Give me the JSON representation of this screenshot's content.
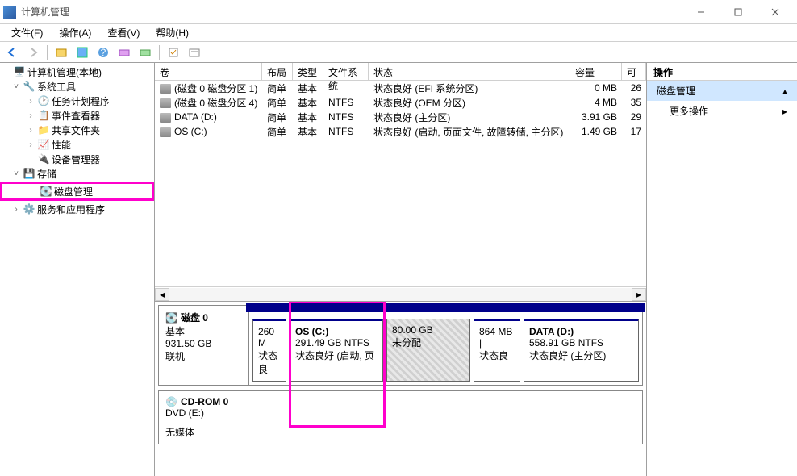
{
  "window": {
    "title": "计算机管理"
  },
  "menu": {
    "file": "文件(F)",
    "action": "操作(A)",
    "view": "查看(V)",
    "help": "帮助(H)"
  },
  "tree": {
    "root": "计算机管理(本地)",
    "systools": "系统工具",
    "tasksched": "任务计划程序",
    "eventvwr": "事件查看器",
    "shared": "共享文件夹",
    "perf": "性能",
    "devmgr": "设备管理器",
    "storage": "存储",
    "diskmgmt": "磁盘管理",
    "services": "服务和应用程序"
  },
  "vol_headers": {
    "volume": "卷",
    "layout": "布局",
    "type": "类型",
    "fs": "文件系统",
    "status": "状态",
    "capacity": "容量",
    "avail": "可"
  },
  "volumes": [
    {
      "name": "(磁盘 0 磁盘分区 1)",
      "layout": "简单",
      "type": "基本",
      "fs": "",
      "status": "状态良好 (EFI 系统分区)",
      "capacity": "0 MB",
      "avail": "26"
    },
    {
      "name": "(磁盘 0 磁盘分区 4)",
      "layout": "简单",
      "type": "基本",
      "fs": "NTFS",
      "status": "状态良好 (OEM 分区)",
      "capacity": "4 MB",
      "avail": "35"
    },
    {
      "name": "DATA (D:)",
      "layout": "简单",
      "type": "基本",
      "fs": "NTFS",
      "status": "状态良好 (主分区)",
      "capacity": "3.91 GB",
      "avail": "29"
    },
    {
      "name": "OS (C:)",
      "layout": "简单",
      "type": "基本",
      "fs": "NTFS",
      "status": "状态良好 (启动, 页面文件, 故障转储, 主分区)",
      "capacity": "1.49 GB",
      "avail": "17"
    }
  ],
  "disk0": {
    "name": "磁盘 0",
    "type": "基本",
    "size": "931.50 GB",
    "status": "联机",
    "p1": {
      "size": "260 M",
      "status": "状态良"
    },
    "p2": {
      "name": "OS  (C:)",
      "size": "291.49 GB NTFS",
      "status": "状态良好 (启动, 页"
    },
    "p3": {
      "size": "80.00 GB",
      "status": "未分配"
    },
    "p4": {
      "size": "864 MB |",
      "status": "状态良"
    },
    "p5": {
      "name": "DATA  (D:)",
      "size": "558.91 GB NTFS",
      "status": "状态良好 (主分区)"
    }
  },
  "cdrom": {
    "name": "CD-ROM 0",
    "drive": "DVD (E:)",
    "status": "无媒体"
  },
  "actions": {
    "header": "操作",
    "diskmgmt": "磁盘管理",
    "more": "更多操作"
  }
}
